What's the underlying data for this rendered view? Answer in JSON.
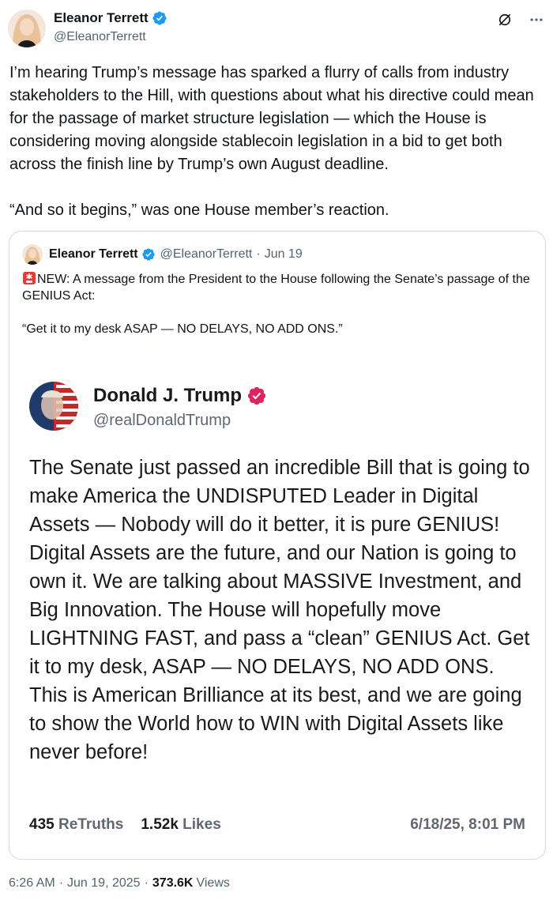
{
  "post": {
    "author_name": "Eleanor Terrett",
    "author_handle": "@EleanorTerrett",
    "text": "I’m hearing Trump’s message has sparked a flurry of calls from industry stakeholders to the Hill, with questions about what his directive could mean for the passage of market structure legislation — which the House is considering moving alongside stablecoin legislation in a bid to get both across the finish line by Trump’s own August deadline.\n\n“And so it begins,” was one House member’s reaction.",
    "time": "6:26 AM",
    "date": "Jun 19, 2025",
    "views_count": "373.6K",
    "views_label": "Views"
  },
  "quote": {
    "author_name": "Eleanor Terrett",
    "author_handle": "@EleanorTerrett",
    "date": "Jun 19",
    "text": "NEW: A message from the President to the House following the Senate’s passage of the GENIUS Act:\n\n“Get it to my desk ASAP — NO DELAYS, NO ADD ONS.”"
  },
  "truth": {
    "author_name": "Donald J. Trump",
    "author_handle": "@realDonaldTrump",
    "text": "The Senate just passed an incredible Bill that is going to make America the UNDISPUTED Leader in Digital Assets — Nobody will do it better, it is pure GENIUS! Digital Assets are the future, and our Nation is going to own it. We are talking about MASSIVE Investment, and Big Innovation. The House will hopefully move LIGHTNING FAST, and pass a “clean” GENIUS Act. Get it to my desk, ASAP — NO DELAYS, NO ADD ONS. This is American Brilliance at its best, and we are going to show the World how to WIN with Digital Assets like never before!",
    "retruths_count": "435",
    "retruths_label": "ReTruths",
    "likes_count": "1.52k",
    "likes_label": "Likes",
    "timestamp": "6/18/25, 8:01 PM"
  },
  "colors": {
    "verified_blue": "#1d9bf0",
    "truth_badge": "#e0245e",
    "secondary_text": "#536471",
    "border": "#cfd9de"
  },
  "icons": {
    "grok": "grok-icon",
    "more": "more-icon",
    "verified": "verified-badge-icon",
    "siren": "siren-icon"
  }
}
